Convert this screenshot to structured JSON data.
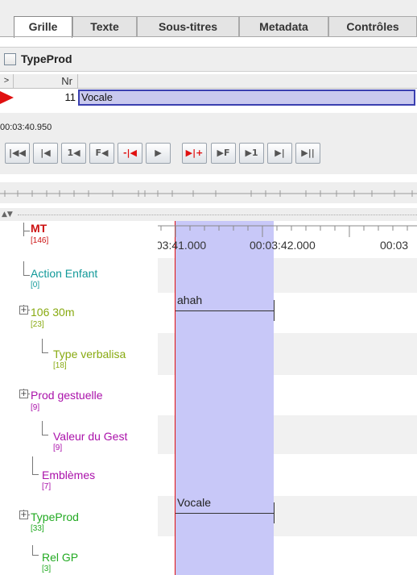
{
  "tabs": [
    {
      "label": "Grille",
      "active": true
    },
    {
      "label": "Texte",
      "active": false
    },
    {
      "label": "Sous-titres",
      "active": false
    },
    {
      "label": "Metadata",
      "active": false
    },
    {
      "label": "Contrôles",
      "active": false
    }
  ],
  "tier_selector": {
    "label": "TypeProd",
    "checked": false
  },
  "grid": {
    "headers": [
      ">",
      "Nr"
    ],
    "rows": [
      {
        "nr": "11",
        "value": "Vocale",
        "selected": true
      }
    ]
  },
  "media": {
    "timecode": "00:03:40.950"
  },
  "controls": [
    {
      "label": "|◀◀",
      "icon": "go-to-begin-icon"
    },
    {
      "label": "|◀",
      "icon": "previous-scroll-view-icon"
    },
    {
      "label": "1◀",
      "icon": "previous-pixel-icon"
    },
    {
      "label": "F◀",
      "icon": "previous-frame-icon"
    },
    {
      "label": "-|◀",
      "icon": "previous-ms-icon"
    },
    {
      "label": "▶",
      "icon": "play-icon"
    },
    {
      "label": "▶|+",
      "icon": "next-ms-icon"
    },
    {
      "label": "▶F",
      "icon": "next-frame-icon"
    },
    {
      "label": "▶1",
      "icon": "next-pixel-icon"
    },
    {
      "label": "▶|",
      "icon": "next-scroll-view-icon"
    },
    {
      "label": "▶||",
      "icon": "go-to-end-icon"
    }
  ],
  "ruler": {
    "labels": [
      ":03:41.000",
      "00:03:42.000",
      "00:03"
    ]
  },
  "tiers": [
    {
      "name": "MT",
      "count": "[146]",
      "color": "#cc1111",
      "bold": true
    },
    {
      "name": "Action Enfant",
      "count": "[0]",
      "color": "#119999"
    },
    {
      "name": "106 30m",
      "count": "[23]",
      "color": "#88aa11"
    },
    {
      "name": "Type verbalisa",
      "count": "[18]",
      "color": "#88aa11"
    },
    {
      "name": "Prod gestuelle",
      "count": "[9]",
      "color": "#aa11aa"
    },
    {
      "name": "Valeur du Gest",
      "count": "[9]",
      "color": "#aa11aa"
    },
    {
      "name": "Emblèmes",
      "count": "[7]",
      "color": "#aa11aa"
    },
    {
      "name": "TypeProd",
      "count": "[33]",
      "color": "#22aa22"
    },
    {
      "name": "Rel GP",
      "count": "[3]",
      "color": "#22aa22"
    }
  ],
  "annotations": [
    {
      "tier": "106 30m",
      "text": "ahah"
    },
    {
      "tier": "TypeProd",
      "text": "Vocale"
    }
  ],
  "colors": {
    "selection": "#c8c8f8",
    "crosshair": "#e01010",
    "grid_selected_row": "#c9c9ee"
  }
}
